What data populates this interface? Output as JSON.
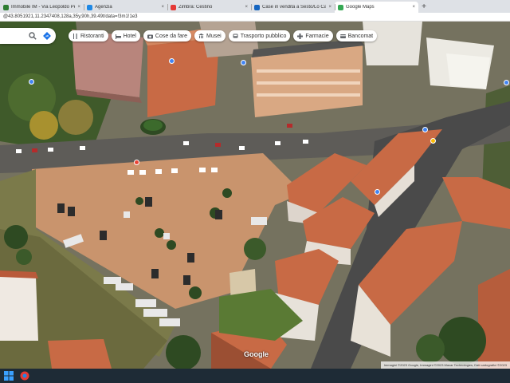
{
  "browser": {
    "tabs": [
      {
        "title": "Immobile IM - Via Leopoldo Per",
        "favicon_color": "#2e7d32",
        "active": false
      },
      {
        "title": "Agenzia",
        "favicon_color": "#1e88e5",
        "active": false
      },
      {
        "title": "Zimbra: Cestino",
        "favicon_color": "#e53935",
        "active": false
      },
      {
        "title": "Case in vendita a Sesto/Lo Casa",
        "favicon_color": "#1565c0",
        "active": false
      },
      {
        "title": "Google Maps",
        "favicon_color": "#34a853",
        "active": true
      }
    ],
    "close_glyph": "×",
    "new_tab_glyph": "+",
    "url": "@43.8051921,11.2347408,128a,35y,90h,39.49t/data=!3m1!1e3"
  },
  "map": {
    "search": {
      "search_icon": "search-icon",
      "directions_icon": "directions-icon"
    },
    "chips": [
      {
        "label": "Ristoranti",
        "icon": "restaurant-icon"
      },
      {
        "label": "Hotel",
        "icon": "hotel-icon"
      },
      {
        "label": "Cose da fare",
        "icon": "camera-icon"
      },
      {
        "label": "Musei",
        "icon": "museum-icon"
      },
      {
        "label": "Trasporto pubblico",
        "icon": "bus-icon"
      },
      {
        "label": "Farmacie",
        "icon": "pharmacy-icon"
      },
      {
        "label": "Bancomat",
        "icon": "atm-icon"
      }
    ],
    "google_logo": "Google",
    "attribution": "Immagini ©2023 Google, Immagini ©2023 Maxar Technologies, Dati cartografici ©2023"
  },
  "colors": {
    "pin_blue": "#4285f4",
    "pin_yellow": "#fbbc04",
    "pin_red": "#ea4335",
    "roof_terracotta": "#c86a45",
    "taskbar": "#1e2b36"
  }
}
